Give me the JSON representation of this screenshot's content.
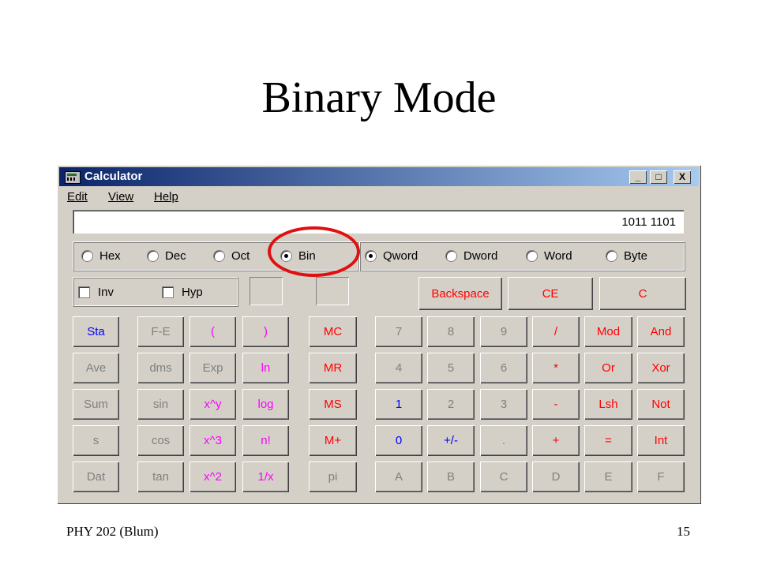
{
  "slide": {
    "title": "Binary Mode",
    "footer_left": "PHY 202 (Blum)",
    "footer_right": "15"
  },
  "window": {
    "title": "Calculator",
    "min_label": "_",
    "max_label": "□",
    "close_label": "X"
  },
  "menu": {
    "edit": "Edit",
    "view": "View",
    "help": "Help"
  },
  "display": {
    "value": "1011 1101"
  },
  "number_system": {
    "hex": "Hex",
    "dec": "Dec",
    "oct": "Oct",
    "bin": "Bin",
    "selected": "Bin"
  },
  "word_size": {
    "qword": "Qword",
    "dword": "Dword",
    "word": "Word",
    "byte": "Byte",
    "selected": "Qword"
  },
  "options": {
    "inv": "Inv",
    "hyp": "Hyp"
  },
  "controls": {
    "backspace": "Backspace",
    "ce": "CE",
    "c": "C"
  },
  "keys": {
    "sta": "Sta",
    "fe": "F-E",
    "lparen": "(",
    "rparen": ")",
    "mc": "MC",
    "k7": "7",
    "k8": "8",
    "k9": "9",
    "div": "/",
    "mod": "Mod",
    "and": "And",
    "ave": "Ave",
    "dms": "dms",
    "exp": "Exp",
    "ln": "ln",
    "mr": "MR",
    "k4": "4",
    "k5": "5",
    "k6": "6",
    "mul": "*",
    "or": "Or",
    "xor": "Xor",
    "sum": "Sum",
    "sin": "sin",
    "xy": "x^y",
    "log": "log",
    "ms": "MS",
    "k1": "1",
    "k2": "2",
    "k3": "3",
    "sub": "-",
    "lsh": "Lsh",
    "not": "Not",
    "s": "s",
    "cos": "cos",
    "x3": "x^3",
    "fact": "n!",
    "mplus": "M+",
    "k0": "0",
    "pm": "+/-",
    "dot": ".",
    "add": "+",
    "eq": "=",
    "int": "Int",
    "dat": "Dat",
    "tan": "tan",
    "x2": "x^2",
    "inv": "1/x",
    "pi": "pi",
    "ka": "A",
    "kb": "B",
    "kc": "C",
    "kd": "D",
    "ke": "E",
    "kf": "F"
  },
  "colors": {
    "highlight_circle": "#e01010",
    "titlebar_start": "#0a246a",
    "titlebar_end": "#a6caf0"
  }
}
